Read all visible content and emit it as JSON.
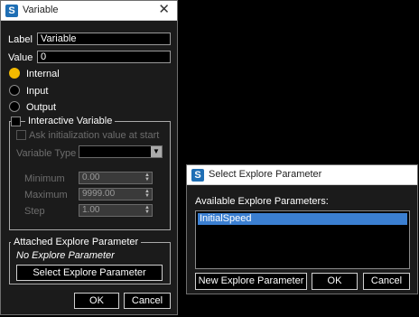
{
  "variable_dialog": {
    "title": "Variable",
    "label_caption": "Label",
    "label_value": "Variable",
    "value_caption": "Value",
    "value_value": "0",
    "radios": [
      {
        "label": "Internal",
        "selected": true
      },
      {
        "label": "Input",
        "selected": false
      },
      {
        "label": "Output",
        "selected": false
      }
    ],
    "interactive": {
      "title": "Interactive Variable",
      "ask_init": "Ask initialization value at start",
      "var_type_label": "Variable Type",
      "min_label": "Minimum",
      "min_value": "0.00",
      "max_label": "Maximum",
      "max_value": "9999.00",
      "step_label": "Step",
      "step_value": "1.00"
    },
    "attached": {
      "title": "Attached Explore Parameter",
      "status": "No Explore Parameter",
      "select_button": "Select Explore Parameter"
    },
    "ok": "OK",
    "cancel": "Cancel"
  },
  "explore_dialog": {
    "title": "Select Explore Parameter",
    "list_label": "Available Explore Parameters:",
    "items": [
      "InitialSpeed"
    ],
    "new_button": "New Explore Parameter",
    "ok": "OK",
    "cancel": "Cancel"
  },
  "colors": {
    "accent": "#f2b900",
    "selection": "#3b7fd1",
    "logo": "#1f6fb5"
  }
}
